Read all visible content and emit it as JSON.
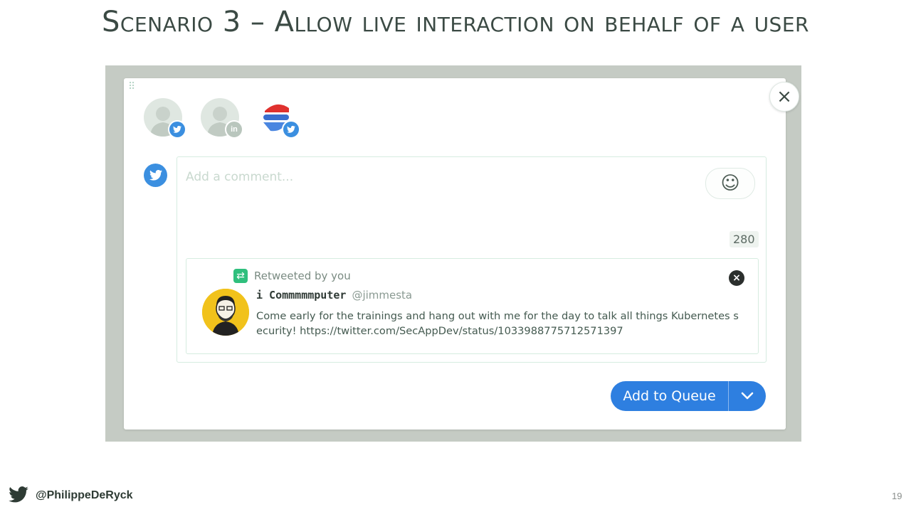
{
  "slide": {
    "title": "Scenario 3 – Allow live interaction on behalf of a user",
    "footer_handle": "@PhilippeDeRyck",
    "page_number": "19"
  },
  "modal": {
    "close_icon": "×",
    "profiles": [
      {
        "network": "twitter",
        "icon": "twitter-icon"
      },
      {
        "network": "linkedin",
        "icon": "linkedin-icon"
      },
      {
        "network": "twitter",
        "icon": "twitter-icon"
      }
    ],
    "composer": {
      "placeholder": "Add a comment...",
      "emoji_icon": "☺",
      "char_count": "280"
    },
    "retweet": {
      "label": "Retweeted by you",
      "author_name": "i Commmmmputer",
      "author_handle": "@jimmesta",
      "text": "Come early for the trainings and hang out with me for the day to talk all things Kubernetes security! https://twitter.com/SecAppDev/status/1033988775712571397",
      "remove_icon": "×"
    },
    "queue_button": {
      "label": "Add to Queue"
    }
  },
  "colors": {
    "twitter_blue": "#3b8fe0",
    "linkedin_blue": "#0a7cc0",
    "primary_button": "#2e7fe0",
    "retweet_green": "#2fbf7d"
  }
}
